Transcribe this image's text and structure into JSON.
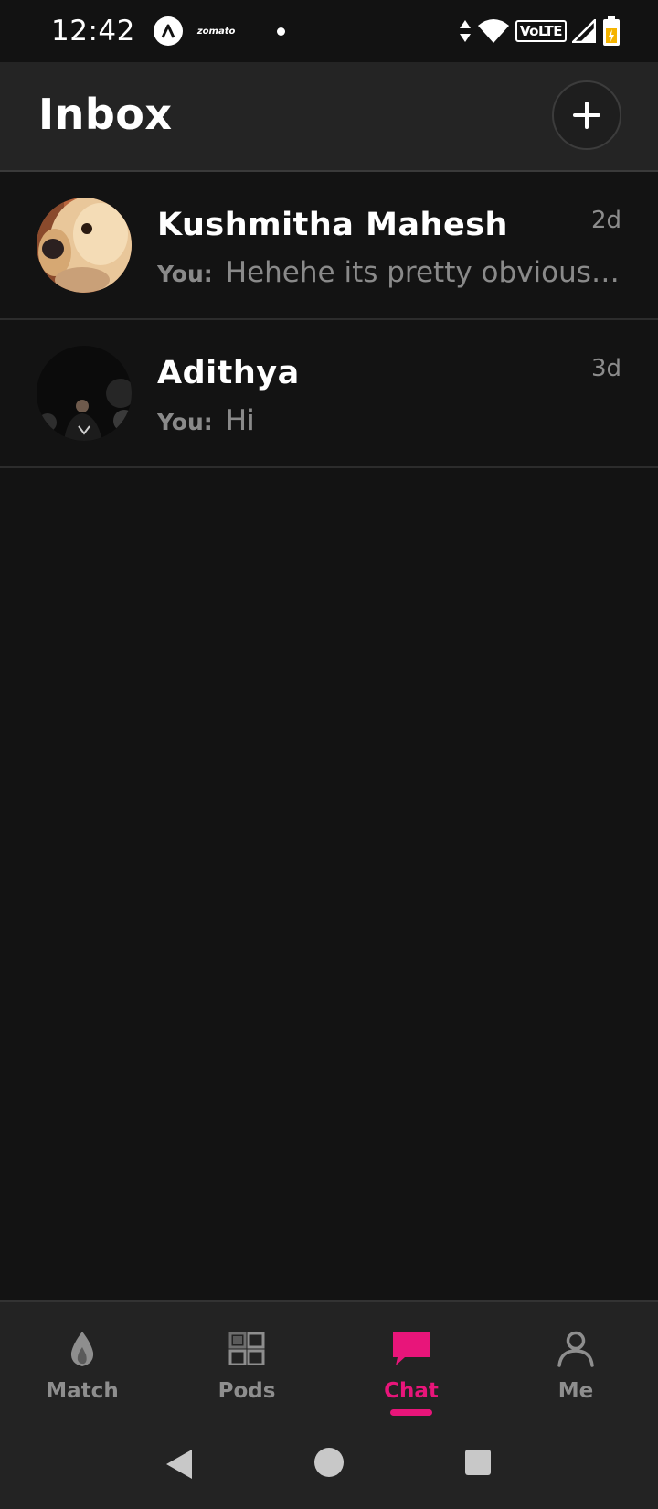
{
  "status_bar": {
    "time": "12:42",
    "app_notice": "zomato",
    "network_label": "VoLTE"
  },
  "header": {
    "title": "Inbox",
    "add_icon": "plus-icon"
  },
  "conversations": [
    {
      "name": "Kushmitha Mahesh",
      "time": "2d",
      "sender": "You:",
      "preview": "Hehehe its pretty obvious …",
      "avatar": "dog-photo"
    },
    {
      "name": "Adithya",
      "time": "3d",
      "sender": "You:",
      "preview": "Hi",
      "avatar": "night-portrait-photo"
    }
  ],
  "bottom_nav": {
    "items": [
      {
        "label": "Match",
        "icon": "flame-icon",
        "active": false
      },
      {
        "label": "Pods",
        "icon": "grid-icon",
        "active": false
      },
      {
        "label": "Chat",
        "icon": "chat-bubble-icon",
        "active": true
      },
      {
        "label": "Me",
        "icon": "person-icon",
        "active": false
      }
    ]
  },
  "colors": {
    "accent": "#e8157a",
    "background": "#131313",
    "header_bg": "#242424",
    "muted_text": "#8a8a8a"
  }
}
